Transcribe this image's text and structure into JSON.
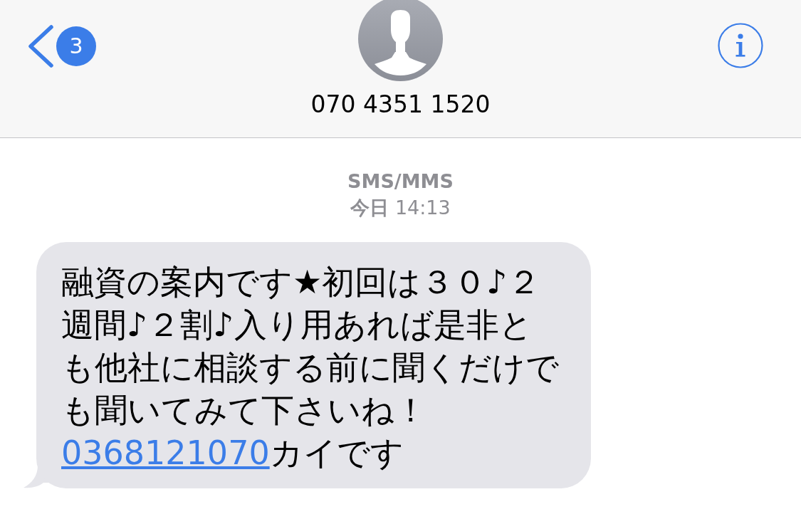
{
  "header": {
    "back": {
      "badge": "3"
    },
    "contact": {
      "name": "070 4351 1520"
    }
  },
  "conversation": {
    "service": "SMS/MMS",
    "timestamp": "**今日** 14:13",
    "messages": [
      {
        "kind": "received",
        "text": "融資の案内です★初回は３０♪２週間♪２割♪入り用あれば是非とも他社に相談する前に聞くだけでも聞いてみて下さいね！",
        "link": "0368121070",
        "after_link": "カイです"
      }
    ]
  }
}
